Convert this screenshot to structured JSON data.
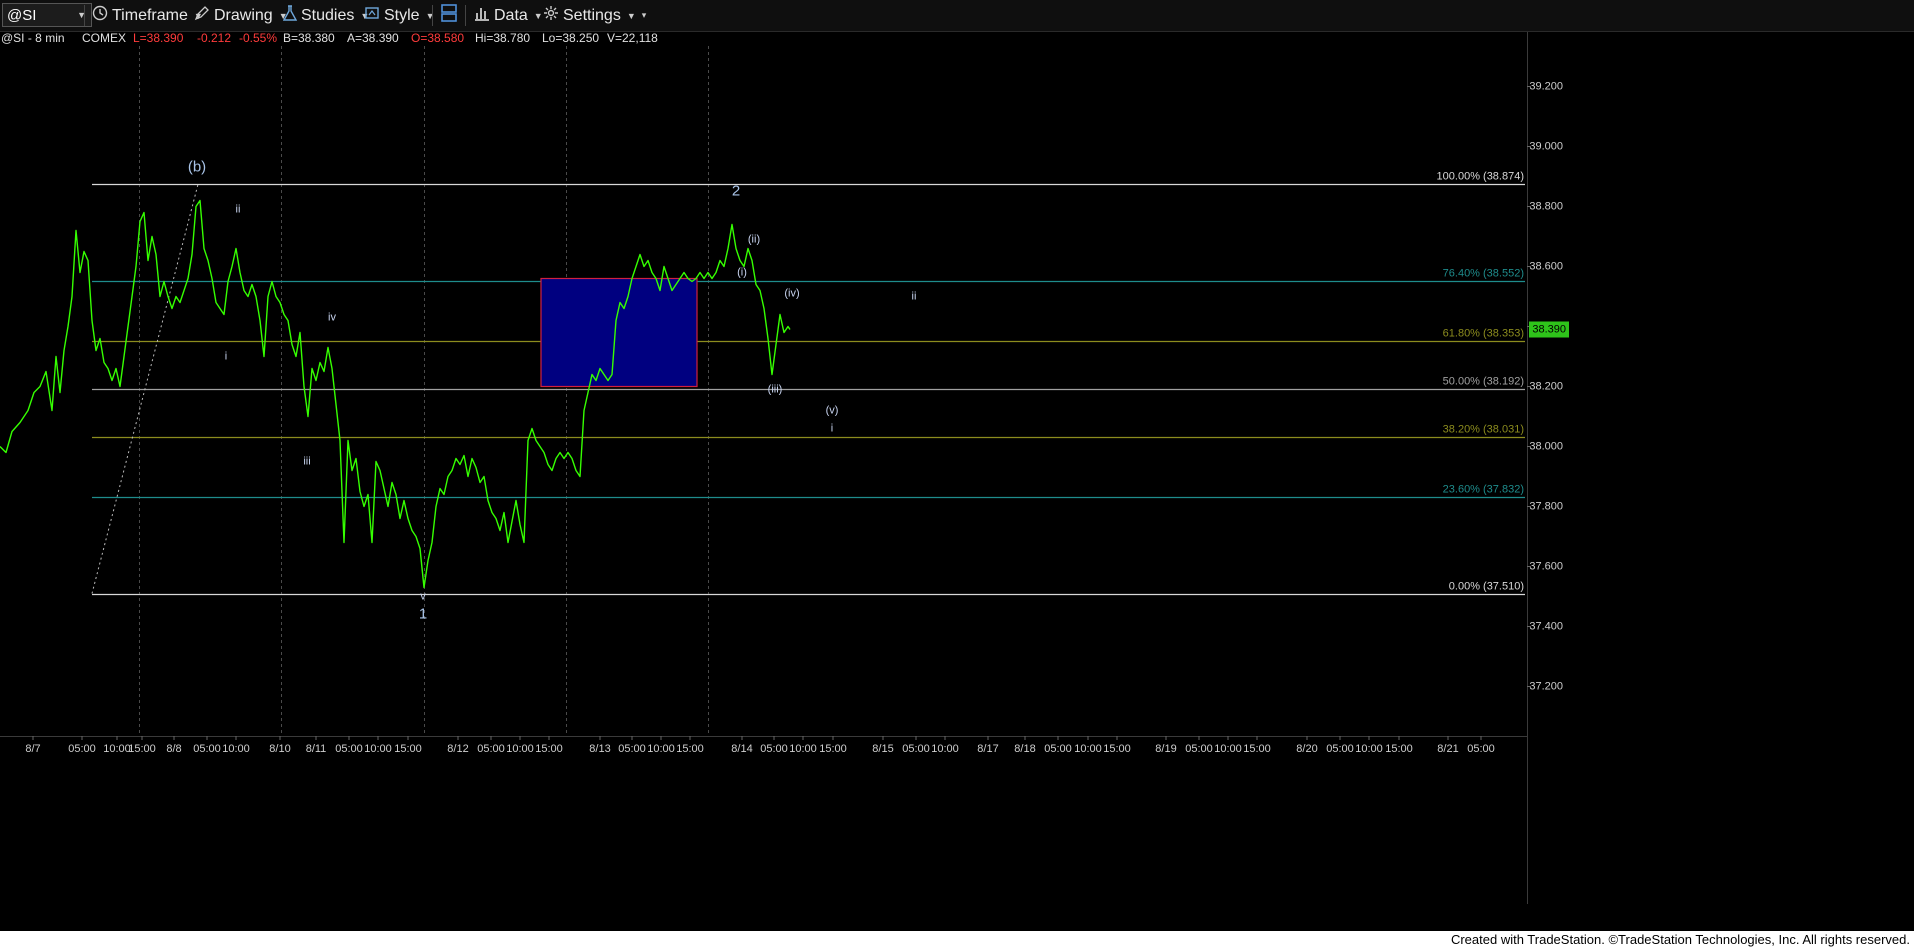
{
  "toolbar": {
    "symbol": "@SI",
    "timeframe_label": "Timeframe",
    "drawing_label": "Drawing",
    "studies_label": "Studies",
    "style_label": "Style",
    "data_label": "Data",
    "settings_label": "Settings",
    "icons": [
      "clock-icon",
      "pencil-icon",
      "flask-icon",
      "style-icon",
      "layout-icon",
      "bar-chart-icon",
      "gear-icon"
    ]
  },
  "info_line": {
    "symbol": "@SI - 8 min",
    "exchange": "COMEX",
    "last": "L=38.390",
    "change": "-0.212",
    "change_pct": "-0.55%",
    "bid": "B=38.380",
    "ask": "A=38.390",
    "open": "O=38.580",
    "high": "Hi=38.780",
    "low": "Lo=38.250",
    "volume": "V=22,118"
  },
  "colors": {
    "price_line": "#35ff00",
    "negative": "#ff3b3b",
    "fib_white": "#d8d8d8",
    "fib_teal": "#1e8c8c",
    "fib_olive": "#8c8c1e",
    "box_fill": "#000080",
    "box_border": "#d02040",
    "price_badge": "#2ec41a"
  },
  "footer": {
    "credit": "Created with TradeStation. ©TradeStation Technologies, Inc. All rights reserved."
  },
  "chart_data": {
    "type": "line",
    "title": "",
    "symbol": "@SI",
    "interval": "8 min",
    "ylim": [
      37.0,
      39.45
    ],
    "y_ticks": [
      "39.200",
      "39.000",
      "38.800",
      "38.600",
      "38.400",
      "38.200",
      "38.000",
      "37.800",
      "37.600",
      "37.400",
      "37.200"
    ],
    "last_price_label": "38.390",
    "x_ticks": [
      "8/7",
      "05:00",
      "10:00",
      "15:00",
      "8/8",
      "05:00",
      "10:00",
      "8/10",
      "8/11",
      "05:00",
      "10:00",
      "15:00",
      "8/12",
      "05:00",
      "10:00",
      "15:00",
      "8/13",
      "05:00",
      "10:00",
      "15:00",
      "8/14",
      "05:00",
      "10:00",
      "15:00",
      "8/15",
      "05:00",
      "10:00",
      "8/17",
      "8/18",
      "05:00",
      "10:00",
      "15:00",
      "8/19",
      "05:00",
      "10:00",
      "15:00",
      "8/20",
      "05:00",
      "10:00",
      "15:00",
      "8/21",
      "05:00"
    ],
    "x_tick_order": [
      0,
      1,
      2,
      3,
      4,
      5,
      6,
      7,
      8,
      9,
      10,
      11,
      12,
      13,
      14,
      15,
      16,
      17,
      18,
      19,
      20,
      21,
      22,
      23,
      24,
      25,
      26,
      27,
      28,
      29,
      30,
      31,
      32,
      33,
      34,
      35,
      36,
      37,
      38,
      39,
      40,
      41
    ],
    "session_breaks": [
      "8/8",
      "8/10",
      "8/12",
      "8/13",
      "8/14"
    ],
    "fib_levels": [
      {
        "label": "100.00% (38.874)",
        "value": 38.874,
        "color": "#d8d8d8"
      },
      {
        "label": "76.40% (38.552)",
        "value": 38.552,
        "color": "#1e8c8c"
      },
      {
        "label": "61.80% (38.353)",
        "value": 38.353,
        "color": "#8c8c1e"
      },
      {
        "label": "50.00% (38.192)",
        "value": 38.192,
        "color": "#a0a0a0"
      },
      {
        "label": "38.20% (38.031)",
        "value": 38.031,
        "color": "#8c8c1e"
      },
      {
        "label": "23.60% (37.832)",
        "value": 37.832,
        "color": "#1e8c8c"
      },
      {
        "label": "0.00% (37.510)",
        "value": 37.51,
        "color": "#d8d8d8"
      }
    ],
    "price_series": [
      [
        0,
        38.0
      ],
      [
        6,
        37.98
      ],
      [
        12,
        38.05
      ],
      [
        20,
        38.08
      ],
      [
        28,
        38.12
      ],
      [
        34,
        38.18
      ],
      [
        40,
        38.2
      ],
      [
        46,
        38.25
      ],
      [
        52,
        38.12
      ],
      [
        56,
        38.3
      ],
      [
        60,
        38.18
      ],
      [
        64,
        38.32
      ],
      [
        68,
        38.4
      ],
      [
        72,
        38.5
      ],
      [
        76,
        38.72
      ],
      [
        80,
        38.58
      ],
      [
        84,
        38.65
      ],
      [
        88,
        38.62
      ],
      [
        92,
        38.42
      ],
      [
        96,
        38.32
      ],
      [
        100,
        38.36
      ],
      [
        104,
        38.28
      ],
      [
        108,
        38.26
      ],
      [
        112,
        38.22
      ],
      [
        116,
        38.26
      ],
      [
        120,
        38.2
      ],
      [
        124,
        38.3
      ],
      [
        128,
        38.4
      ],
      [
        132,
        38.5
      ],
      [
        136,
        38.6
      ],
      [
        140,
        38.75
      ],
      [
        144,
        38.78
      ],
      [
        148,
        38.62
      ],
      [
        152,
        38.7
      ],
      [
        156,
        38.64
      ],
      [
        160,
        38.5
      ],
      [
        164,
        38.55
      ],
      [
        168,
        38.5
      ],
      [
        172,
        38.46
      ],
      [
        176,
        38.5
      ],
      [
        180,
        38.48
      ],
      [
        184,
        38.52
      ],
      [
        188,
        38.56
      ],
      [
        192,
        38.64
      ],
      [
        196,
        38.8
      ],
      [
        200,
        38.82
      ],
      [
        204,
        38.66
      ],
      [
        208,
        38.62
      ],
      [
        212,
        38.56
      ],
      [
        216,
        38.48
      ],
      [
        220,
        38.46
      ],
      [
        224,
        38.44
      ],
      [
        228,
        38.55
      ],
      [
        232,
        38.6
      ],
      [
        236,
        38.66
      ],
      [
        240,
        38.58
      ],
      [
        244,
        38.52
      ],
      [
        248,
        38.5
      ],
      [
        252,
        38.54
      ],
      [
        256,
        38.5
      ],
      [
        260,
        38.42
      ],
      [
        264,
        38.3
      ],
      [
        268,
        38.5
      ],
      [
        272,
        38.55
      ],
      [
        276,
        38.5
      ],
      [
        280,
        38.48
      ],
      [
        284,
        38.44
      ],
      [
        288,
        38.42
      ],
      [
        292,
        38.34
      ],
      [
        296,
        38.3
      ],
      [
        300,
        38.38
      ],
      [
        304,
        38.2
      ],
      [
        308,
        38.1
      ],
      [
        312,
        38.26
      ],
      [
        316,
        38.22
      ],
      [
        320,
        38.28
      ],
      [
        324,
        38.25
      ],
      [
        328,
        38.33
      ],
      [
        332,
        38.26
      ],
      [
        336,
        38.14
      ],
      [
        340,
        38.02
      ],
      [
        344,
        37.68
      ],
      [
        348,
        38.02
      ],
      [
        352,
        37.92
      ],
      [
        356,
        37.96
      ],
      [
        360,
        37.85
      ],
      [
        364,
        37.8
      ],
      [
        368,
        37.84
      ],
      [
        372,
        37.68
      ],
      [
        376,
        37.95
      ],
      [
        380,
        37.92
      ],
      [
        384,
        37.86
      ],
      [
        388,
        37.8
      ],
      [
        392,
        37.88
      ],
      [
        396,
        37.84
      ],
      [
        400,
        37.76
      ],
      [
        404,
        37.82
      ],
      [
        408,
        37.76
      ],
      [
        412,
        37.72
      ],
      [
        416,
        37.7
      ],
      [
        420,
        37.66
      ],
      [
        424,
        37.53
      ],
      [
        428,
        37.62
      ],
      [
        432,
        37.68
      ],
      [
        436,
        37.8
      ],
      [
        440,
        37.86
      ],
      [
        444,
        37.84
      ],
      [
        448,
        37.9
      ],
      [
        452,
        37.92
      ],
      [
        456,
        37.96
      ],
      [
        460,
        37.94
      ],
      [
        464,
        37.97
      ],
      [
        468,
        37.9
      ],
      [
        472,
        37.96
      ],
      [
        476,
        37.93
      ],
      [
        480,
        37.88
      ],
      [
        484,
        37.9
      ],
      [
        488,
        37.82
      ],
      [
        492,
        37.78
      ],
      [
        496,
        37.76
      ],
      [
        500,
        37.72
      ],
      [
        504,
        37.78
      ],
      [
        508,
        37.68
      ],
      [
        512,
        37.75
      ],
      [
        516,
        37.82
      ],
      [
        520,
        37.74
      ],
      [
        524,
        37.68
      ],
      [
        528,
        38.02
      ],
      [
        532,
        38.06
      ],
      [
        536,
        38.02
      ],
      [
        540,
        38.0
      ],
      [
        544,
        37.98
      ],
      [
        548,
        37.94
      ],
      [
        552,
        37.92
      ],
      [
        556,
        37.96
      ],
      [
        560,
        37.98
      ],
      [
        564,
        37.96
      ],
      [
        568,
        37.98
      ],
      [
        572,
        37.96
      ],
      [
        576,
        37.92
      ],
      [
        580,
        37.9
      ],
      [
        584,
        38.12
      ],
      [
        588,
        38.18
      ],
      [
        592,
        38.24
      ],
      [
        596,
        38.22
      ],
      [
        600,
        38.26
      ],
      [
        604,
        38.24
      ],
      [
        608,
        38.22
      ],
      [
        612,
        38.24
      ],
      [
        616,
        38.42
      ],
      [
        620,
        38.48
      ],
      [
        624,
        38.46
      ],
      [
        628,
        38.5
      ],
      [
        632,
        38.56
      ],
      [
        636,
        38.6
      ],
      [
        640,
        38.64
      ],
      [
        644,
        38.6
      ],
      [
        648,
        38.62
      ],
      [
        652,
        38.58
      ],
      [
        656,
        38.56
      ],
      [
        660,
        38.52
      ],
      [
        664,
        38.6
      ],
      [
        668,
        38.56
      ],
      [
        672,
        38.52
      ],
      [
        676,
        38.54
      ],
      [
        680,
        38.56
      ],
      [
        684,
        38.58
      ],
      [
        688,
        38.56
      ],
      [
        692,
        38.55
      ],
      [
        696,
        38.56
      ],
      [
        700,
        38.58
      ],
      [
        704,
        38.56
      ],
      [
        708,
        38.58
      ],
      [
        712,
        38.56
      ],
      [
        716,
        38.58
      ],
      [
        720,
        38.62
      ],
      [
        724,
        38.6
      ],
      [
        728,
        38.66
      ],
      [
        732,
        38.74
      ],
      [
        736,
        38.66
      ],
      [
        740,
        38.62
      ],
      [
        744,
        38.6
      ],
      [
        748,
        38.66
      ],
      [
        752,
        38.62
      ],
      [
        756,
        38.54
      ],
      [
        760,
        38.52
      ],
      [
        764,
        38.46
      ],
      [
        768,
        38.36
      ],
      [
        772,
        38.24
      ],
      [
        776,
        38.34
      ],
      [
        780,
        38.44
      ],
      [
        784,
        38.38
      ],
      [
        788,
        38.4
      ],
      [
        790,
        38.39
      ]
    ],
    "wave_labels": [
      {
        "text": "(b)",
        "x": 197,
        "y": 38.93
      },
      {
        "text": "ii",
        "x": 238,
        "y": 38.79
      },
      {
        "text": "i",
        "x": 226,
        "y": 38.3
      },
      {
        "text": "iv",
        "x": 332,
        "y": 38.43
      },
      {
        "text": "iii",
        "x": 307,
        "y": 37.95
      },
      {
        "text": "v",
        "x": 423,
        "y": 37.5
      },
      {
        "text": "1",
        "x": 423,
        "y": 37.44
      },
      {
        "text": "2",
        "x": 736,
        "y": 38.85
      },
      {
        "text": "(ii)",
        "x": 754,
        "y": 38.69
      },
      {
        "text": "(i)",
        "x": 742,
        "y": 38.58
      },
      {
        "text": "(iv)",
        "x": 792,
        "y": 38.51
      },
      {
        "text": "ii",
        "x": 914,
        "y": 38.5
      },
      {
        "text": "(iii)",
        "x": 775,
        "y": 38.19
      },
      {
        "text": "(v)",
        "x": 832,
        "y": 38.12
      },
      {
        "text": "i",
        "x": 832,
        "y": 38.06
      }
    ],
    "target_box": {
      "x_start": 541,
      "x_end": 697,
      "y_top": 38.56,
      "y_bottom": 38.2
    },
    "trendline": {
      "from": [
        92,
        37.51
      ],
      "to": [
        198,
        38.874
      ]
    },
    "x_range": [
      0,
      1528
    ],
    "grid": false,
    "legend": "none"
  }
}
